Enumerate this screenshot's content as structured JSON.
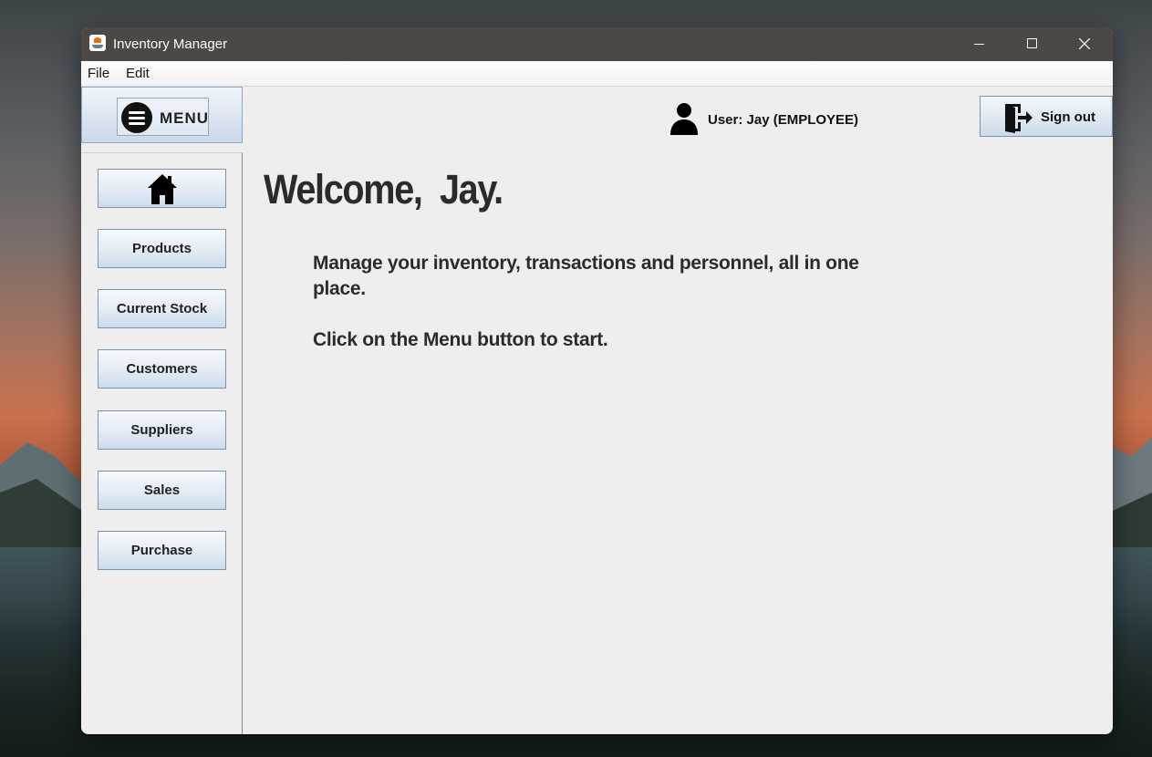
{
  "window": {
    "title": "Inventory Manager"
  },
  "menubar": {
    "file": "File",
    "edit": "Edit"
  },
  "menu_toggle": {
    "label": "MENU",
    "icon": "hamburger-icon"
  },
  "user": {
    "label": "User: Jay (EMPLOYEE)",
    "icon": "user-icon"
  },
  "signout": {
    "label": "Sign out",
    "icon": "exit-door-icon"
  },
  "sidebar": {
    "home_icon": "home-icon",
    "items": [
      {
        "label": "Products"
      },
      {
        "label": "Current Stock"
      },
      {
        "label": "Customers"
      },
      {
        "label": "Suppliers"
      },
      {
        "label": "Sales"
      },
      {
        "label": "Purchase"
      }
    ]
  },
  "main": {
    "welcome": "Welcome,  Jay.",
    "description": "Manage your inventory, transactions and personnel, all in one place.",
    "hint": "Click on the Menu button to start."
  },
  "colors": {
    "titlebar": "#4b4846",
    "panel": "#eeeeee",
    "button_border": "#7e94ac"
  }
}
